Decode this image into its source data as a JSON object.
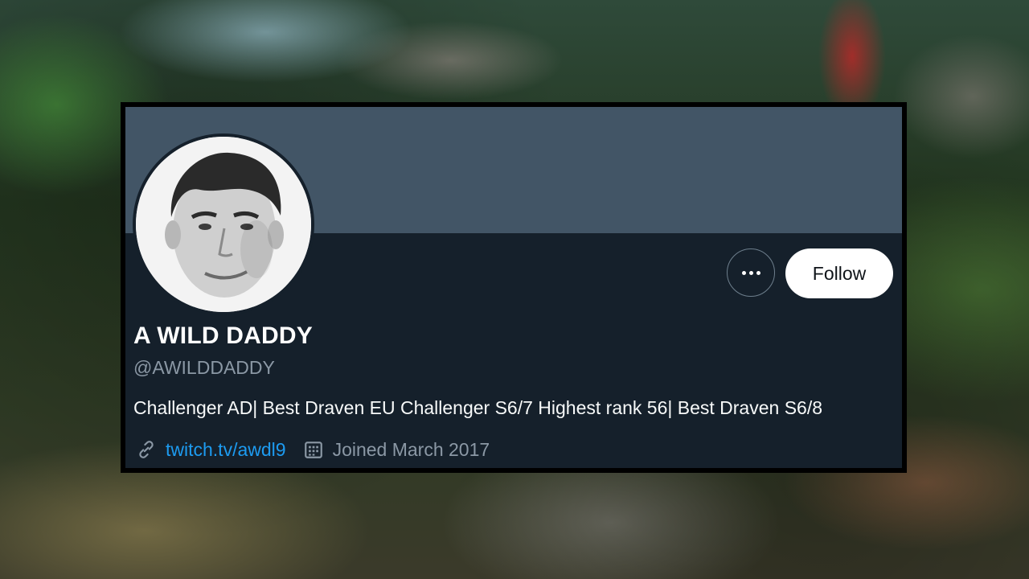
{
  "profile": {
    "display_name": "A WILD DADDY",
    "handle": "@AWILDDADDY",
    "bio": "Challenger AD| Best Draven EU Challenger S6/7 Highest rank 56| Best Draven S6/8",
    "link_text": "twitch.tv/awdl9",
    "joined_text": "Joined March 2017",
    "follow_label": "Follow",
    "more_icon": "more-horizontal-icon",
    "link_icon": "link-icon",
    "calendar_icon": "calendar-icon"
  },
  "colors": {
    "banner": "#425566",
    "card_background": "#15202b",
    "link": "#1d9bf0",
    "secondary_text": "#8b98a5",
    "follow_button_bg": "#ffffff"
  }
}
